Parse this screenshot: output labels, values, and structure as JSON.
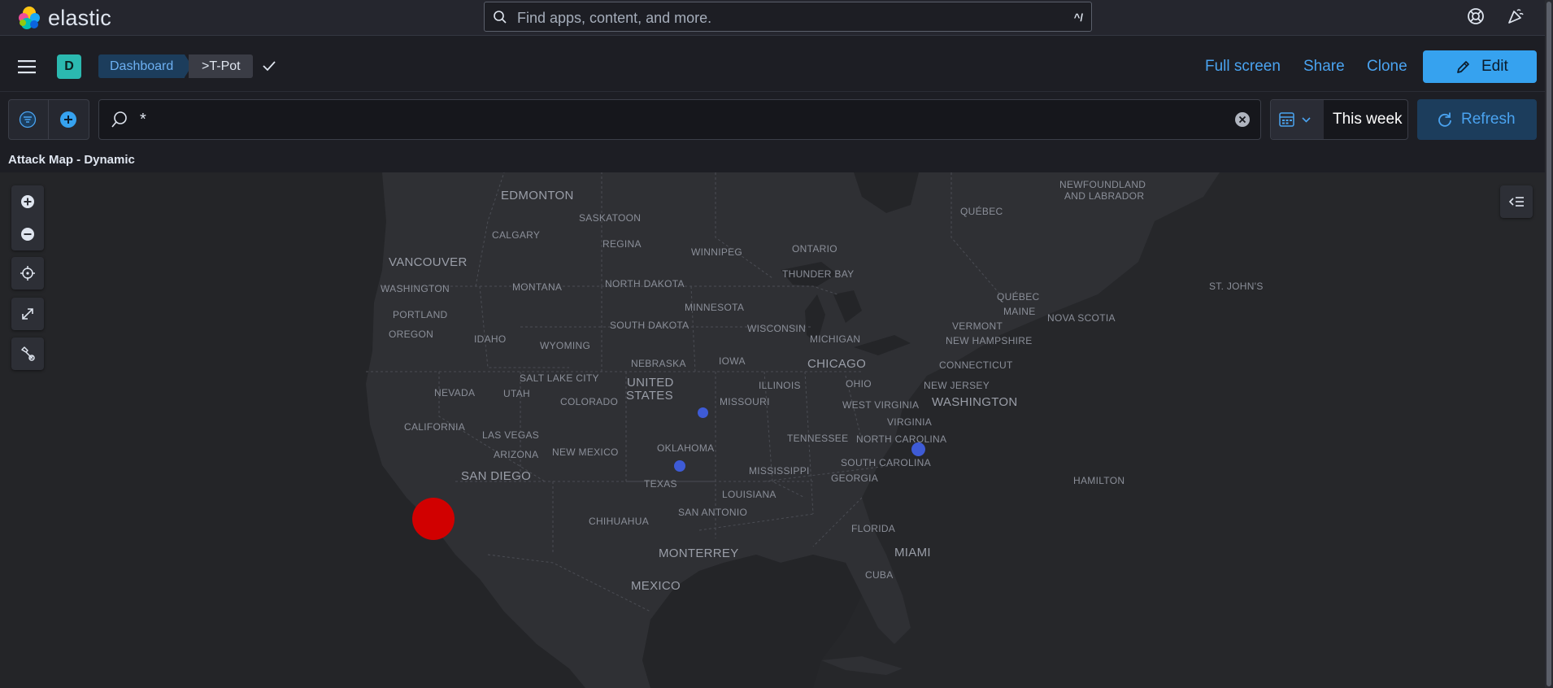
{
  "header": {
    "brand": "elastic",
    "search_placeholder": "Find apps, content, and more.",
    "search_shortcut": "^/"
  },
  "nav": {
    "space_initial": "D",
    "breadcrumbs": [
      "Dashboard",
      ">T-Pot"
    ],
    "actions": {
      "full_screen": "Full screen",
      "share": "Share",
      "clone": "Clone",
      "edit": "Edit"
    }
  },
  "query": {
    "value": "*",
    "date_range": "This week",
    "refresh": "Refresh"
  },
  "panel": {
    "title": "Attack Map - Dynamic"
  },
  "map": {
    "labels": {
      "edmonton": "EDMONTON",
      "saskatoon": "SASKATOON",
      "calgary": "CALGARY",
      "regina": "REGINA",
      "winnipeg": "WINNIPEG",
      "ontario": "ONTARIO",
      "quebec1": "QUÉBEC",
      "newfoundland1": "NEWFOUNDLAND",
      "newfoundland2": "AND LABRADOR",
      "vancouver": "VANCOUVER",
      "thunder_bay": "THUNDER BAY",
      "washington_state": "WASHINGTON",
      "montana": "MONTANA",
      "north_dakota": "NORTH DAKOTA",
      "minnesota": "MINNESOTA",
      "st_johns": "ST. JOHN'S",
      "quebec2": "QUÉBEC",
      "maine": "MAINE",
      "portland": "PORTLAND",
      "nova_scotia": "NOVA SCOTIA",
      "south_dakota": "SOUTH DAKOTA",
      "wisconsin": "WISCONSIN",
      "vermont": "VERMONT",
      "oregon": "OREGON",
      "idaho": "IDAHO",
      "wyoming": "WYOMING",
      "michigan": "MICHIGAN",
      "new_hampshire": "NEW HAMPSHIRE",
      "nebraska": "NEBRASKA",
      "iowa": "IOWA",
      "chicago": "CHICAGO",
      "connecticut": "CONNECTICUT",
      "salt_lake_city": "SALT LAKE CITY",
      "nevada": "NEVADA",
      "united": "UNITED",
      "states": "STATES",
      "illinois": "ILLINOIS",
      "ohio": "OHIO",
      "new_jersey": "NEW JERSEY",
      "utah": "UTAH",
      "colorado": "COLORADO",
      "missouri": "MISSOURI",
      "west_virginia": "WEST VIRGINIA",
      "washington_dc": "WASHINGTON",
      "virginia": "VIRGINIA",
      "california": "CALIFORNIA",
      "las_vegas": "LAS VEGAS",
      "tennessee": "TENNESSEE",
      "north_carolina": "NORTH CAROLINA",
      "arizona": "ARIZONA",
      "oklahoma": "OKLAHOMA",
      "new_mexico": "NEW MEXICO",
      "south_carolina": "SOUTH CAROLINA",
      "mississippi": "MISSISSIPPI",
      "san_diego": "SAN DIEGO",
      "georgia": "GEORGIA",
      "hamilton": "HAMILTON",
      "texas": "TEXAS",
      "louisiana": "LOUISIANA",
      "san_antonio": "SAN ANTONIO",
      "chihuahua": "CHIHUAHUA",
      "florida": "FLORIDA",
      "monterrey": "MONTERREY",
      "miami": "MIAMI",
      "cuba": "CUBA",
      "mexico": "MEXICO"
    },
    "colors": {
      "large_attack": "#d10000",
      "small_attack": "#3e5bd6"
    }
  }
}
